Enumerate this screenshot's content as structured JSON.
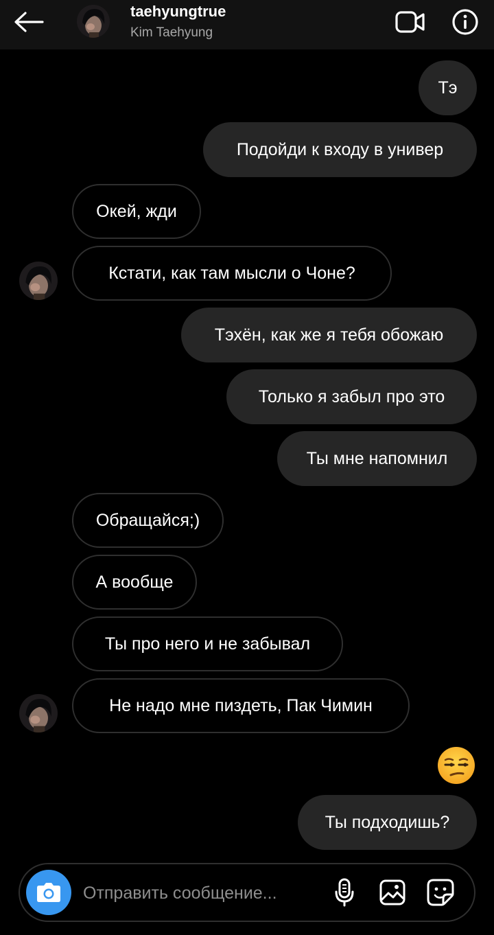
{
  "header": {
    "username": "taehyungtrue",
    "display_name": "Kim Taehyung",
    "icons": {
      "back": "arrow-left-icon",
      "video": "video-camera-icon",
      "info": "info-icon"
    }
  },
  "messages": [
    {
      "direction": "sent",
      "text": "Тэ"
    },
    {
      "direction": "sent",
      "text": "Подойди к входу в универ"
    },
    {
      "direction": "received",
      "text": "Окей, жди"
    },
    {
      "direction": "received",
      "text": "Кстати, как там мысли о Чоне?",
      "avatar": true
    },
    {
      "direction": "sent",
      "text": "Тэхён, как же я тебя обожаю"
    },
    {
      "direction": "sent",
      "text": "Только я забыл про это"
    },
    {
      "direction": "sent",
      "text": "Ты мне напомнил"
    },
    {
      "direction": "received",
      "text": "Обращайся;)"
    },
    {
      "direction": "received",
      "text": "А вообще"
    },
    {
      "direction": "received",
      "text": "Ты про него и не забывал"
    },
    {
      "direction": "received",
      "text": "Не надо мне пиздеть, Пак Чимин",
      "avatar": true
    },
    {
      "direction": "sent",
      "type": "emoji",
      "emoji": "unamused-face"
    },
    {
      "direction": "sent",
      "text": "Ты подходишь?"
    }
  ],
  "composer": {
    "placeholder": "Отправить сообщение...",
    "icons": [
      "camera-icon",
      "microphone-icon",
      "gallery-icon",
      "sticker-icon"
    ]
  },
  "colors": {
    "background": "#000000",
    "header_bg": "#121212",
    "sent_bubble": "#262626",
    "received_border": "#2f2f2f",
    "camera_button": "#3897f0",
    "placeholder": "#8e8e8e"
  }
}
